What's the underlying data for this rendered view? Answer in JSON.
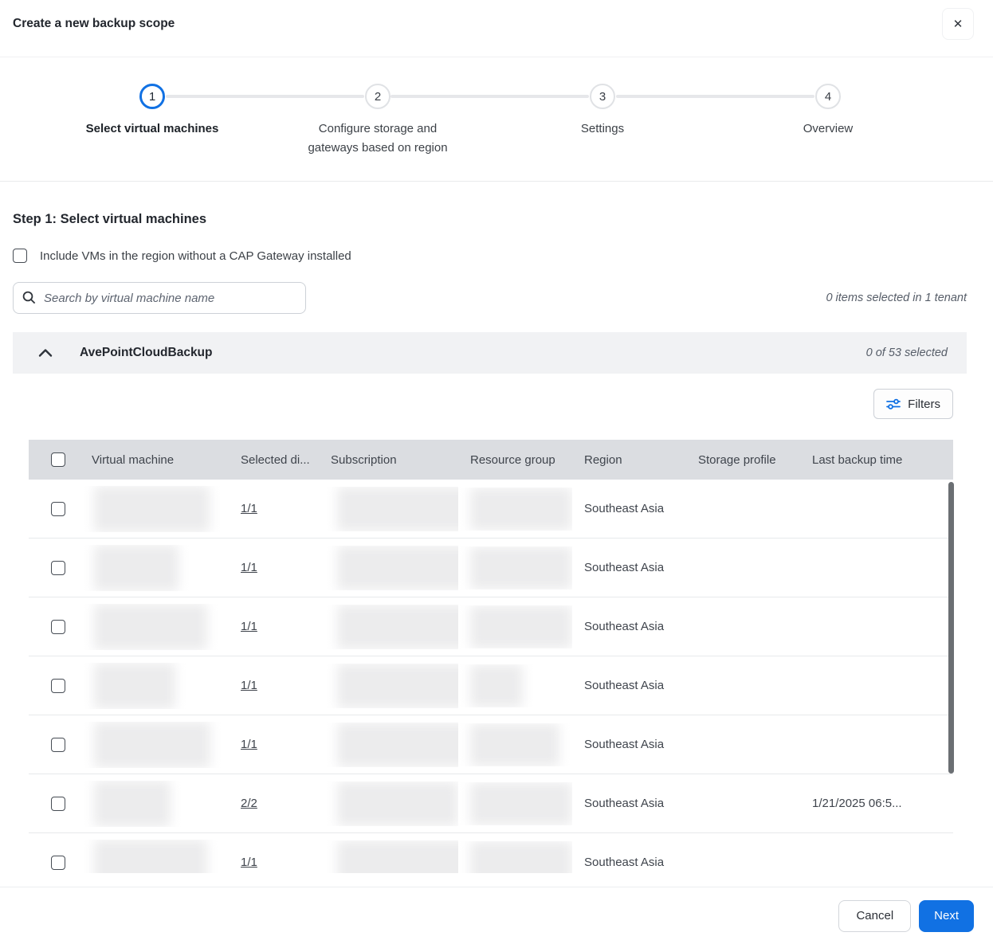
{
  "dialog": {
    "title": "Create a new backup scope",
    "close_icon": "✕"
  },
  "stepper": {
    "steps": [
      {
        "number": "1",
        "label": "Select virtual machines",
        "state": "active"
      },
      {
        "number": "2",
        "label": "Configure storage and gateways based on region",
        "state": "upcoming"
      },
      {
        "number": "3",
        "label": "Settings",
        "state": "upcoming"
      },
      {
        "number": "4",
        "label": "Overview",
        "state": "upcoming"
      }
    ]
  },
  "step_heading": "Step 1: Select virtual machines",
  "include_checkbox": {
    "label": "Include VMs in the region without a CAP Gateway installed",
    "checked": false
  },
  "search": {
    "placeholder": "Search by virtual machine name",
    "value": ""
  },
  "selection_summary": "0 items selected in 1 tenant",
  "tenant_section": {
    "name": "AvePointCloudBackup",
    "selected_summary": "0 of 53 selected",
    "filters_label": "Filters"
  },
  "table": {
    "columns": [
      "Virtual machine",
      "Selected di...",
      "Subscription",
      "Resource group",
      "Region",
      "Storage profile",
      "Last backup time"
    ],
    "redacted_columns": [
      "Virtual machine",
      "Subscription",
      "Resource group"
    ],
    "rows": [
      {
        "selected_disks": "1/1",
        "region": "Southeast Asia",
        "storage_profile": "",
        "last_backup_time": ""
      },
      {
        "selected_disks": "1/1",
        "region": "Southeast Asia",
        "storage_profile": "",
        "last_backup_time": ""
      },
      {
        "selected_disks": "1/1",
        "region": "Southeast Asia",
        "storage_profile": "",
        "last_backup_time": ""
      },
      {
        "selected_disks": "1/1",
        "region": "Southeast Asia",
        "storage_profile": "",
        "last_backup_time": ""
      },
      {
        "selected_disks": "1/1",
        "region": "Southeast Asia",
        "storage_profile": "",
        "last_backup_time": ""
      },
      {
        "selected_disks": "2/2",
        "region": "Southeast Asia",
        "storage_profile": "",
        "last_backup_time": "1/21/2025 06:5..."
      },
      {
        "selected_disks": "1/1",
        "region": "Southeast Asia",
        "storage_profile": "",
        "last_backup_time": ""
      }
    ]
  },
  "footer": {
    "cancel_label": "Cancel",
    "next_label": "Next"
  },
  "colors": {
    "accent_blue": "#1171e3",
    "section_header_bg": "#f1f2f4",
    "table_header_bg": "#dbdde1",
    "scrollbar": "#6b6f73"
  }
}
